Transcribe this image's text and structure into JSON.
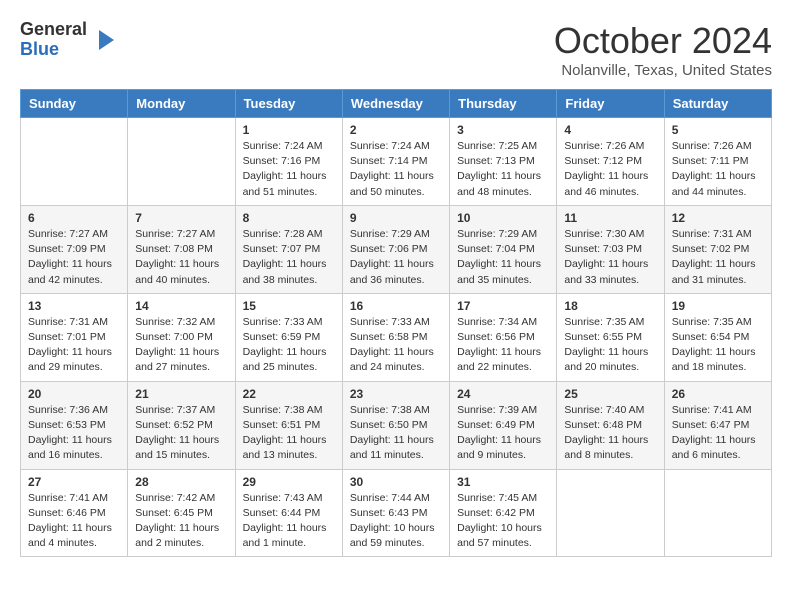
{
  "header": {
    "logo_general": "General",
    "logo_blue": "Blue",
    "month_title": "October 2024",
    "location": "Nolanville, Texas, United States"
  },
  "days_of_week": [
    "Sunday",
    "Monday",
    "Tuesday",
    "Wednesday",
    "Thursday",
    "Friday",
    "Saturday"
  ],
  "weeks": [
    [
      {
        "day": "",
        "info": ""
      },
      {
        "day": "",
        "info": ""
      },
      {
        "day": "1",
        "info": "Sunrise: 7:24 AM\nSunset: 7:16 PM\nDaylight: 11 hours and 51 minutes."
      },
      {
        "day": "2",
        "info": "Sunrise: 7:24 AM\nSunset: 7:14 PM\nDaylight: 11 hours and 50 minutes."
      },
      {
        "day": "3",
        "info": "Sunrise: 7:25 AM\nSunset: 7:13 PM\nDaylight: 11 hours and 48 minutes."
      },
      {
        "day": "4",
        "info": "Sunrise: 7:26 AM\nSunset: 7:12 PM\nDaylight: 11 hours and 46 minutes."
      },
      {
        "day": "5",
        "info": "Sunrise: 7:26 AM\nSunset: 7:11 PM\nDaylight: 11 hours and 44 minutes."
      }
    ],
    [
      {
        "day": "6",
        "info": "Sunrise: 7:27 AM\nSunset: 7:09 PM\nDaylight: 11 hours and 42 minutes."
      },
      {
        "day": "7",
        "info": "Sunrise: 7:27 AM\nSunset: 7:08 PM\nDaylight: 11 hours and 40 minutes."
      },
      {
        "day": "8",
        "info": "Sunrise: 7:28 AM\nSunset: 7:07 PM\nDaylight: 11 hours and 38 minutes."
      },
      {
        "day": "9",
        "info": "Sunrise: 7:29 AM\nSunset: 7:06 PM\nDaylight: 11 hours and 36 minutes."
      },
      {
        "day": "10",
        "info": "Sunrise: 7:29 AM\nSunset: 7:04 PM\nDaylight: 11 hours and 35 minutes."
      },
      {
        "day": "11",
        "info": "Sunrise: 7:30 AM\nSunset: 7:03 PM\nDaylight: 11 hours and 33 minutes."
      },
      {
        "day": "12",
        "info": "Sunrise: 7:31 AM\nSunset: 7:02 PM\nDaylight: 11 hours and 31 minutes."
      }
    ],
    [
      {
        "day": "13",
        "info": "Sunrise: 7:31 AM\nSunset: 7:01 PM\nDaylight: 11 hours and 29 minutes."
      },
      {
        "day": "14",
        "info": "Sunrise: 7:32 AM\nSunset: 7:00 PM\nDaylight: 11 hours and 27 minutes."
      },
      {
        "day": "15",
        "info": "Sunrise: 7:33 AM\nSunset: 6:59 PM\nDaylight: 11 hours and 25 minutes."
      },
      {
        "day": "16",
        "info": "Sunrise: 7:33 AM\nSunset: 6:58 PM\nDaylight: 11 hours and 24 minutes."
      },
      {
        "day": "17",
        "info": "Sunrise: 7:34 AM\nSunset: 6:56 PM\nDaylight: 11 hours and 22 minutes."
      },
      {
        "day": "18",
        "info": "Sunrise: 7:35 AM\nSunset: 6:55 PM\nDaylight: 11 hours and 20 minutes."
      },
      {
        "day": "19",
        "info": "Sunrise: 7:35 AM\nSunset: 6:54 PM\nDaylight: 11 hours and 18 minutes."
      }
    ],
    [
      {
        "day": "20",
        "info": "Sunrise: 7:36 AM\nSunset: 6:53 PM\nDaylight: 11 hours and 16 minutes."
      },
      {
        "day": "21",
        "info": "Sunrise: 7:37 AM\nSunset: 6:52 PM\nDaylight: 11 hours and 15 minutes."
      },
      {
        "day": "22",
        "info": "Sunrise: 7:38 AM\nSunset: 6:51 PM\nDaylight: 11 hours and 13 minutes."
      },
      {
        "day": "23",
        "info": "Sunrise: 7:38 AM\nSunset: 6:50 PM\nDaylight: 11 hours and 11 minutes."
      },
      {
        "day": "24",
        "info": "Sunrise: 7:39 AM\nSunset: 6:49 PM\nDaylight: 11 hours and 9 minutes."
      },
      {
        "day": "25",
        "info": "Sunrise: 7:40 AM\nSunset: 6:48 PM\nDaylight: 11 hours and 8 minutes."
      },
      {
        "day": "26",
        "info": "Sunrise: 7:41 AM\nSunset: 6:47 PM\nDaylight: 11 hours and 6 minutes."
      }
    ],
    [
      {
        "day": "27",
        "info": "Sunrise: 7:41 AM\nSunset: 6:46 PM\nDaylight: 11 hours and 4 minutes."
      },
      {
        "day": "28",
        "info": "Sunrise: 7:42 AM\nSunset: 6:45 PM\nDaylight: 11 hours and 2 minutes."
      },
      {
        "day": "29",
        "info": "Sunrise: 7:43 AM\nSunset: 6:44 PM\nDaylight: 11 hours and 1 minute."
      },
      {
        "day": "30",
        "info": "Sunrise: 7:44 AM\nSunset: 6:43 PM\nDaylight: 10 hours and 59 minutes."
      },
      {
        "day": "31",
        "info": "Sunrise: 7:45 AM\nSunset: 6:42 PM\nDaylight: 10 hours and 57 minutes."
      },
      {
        "day": "",
        "info": ""
      },
      {
        "day": "",
        "info": ""
      }
    ]
  ]
}
